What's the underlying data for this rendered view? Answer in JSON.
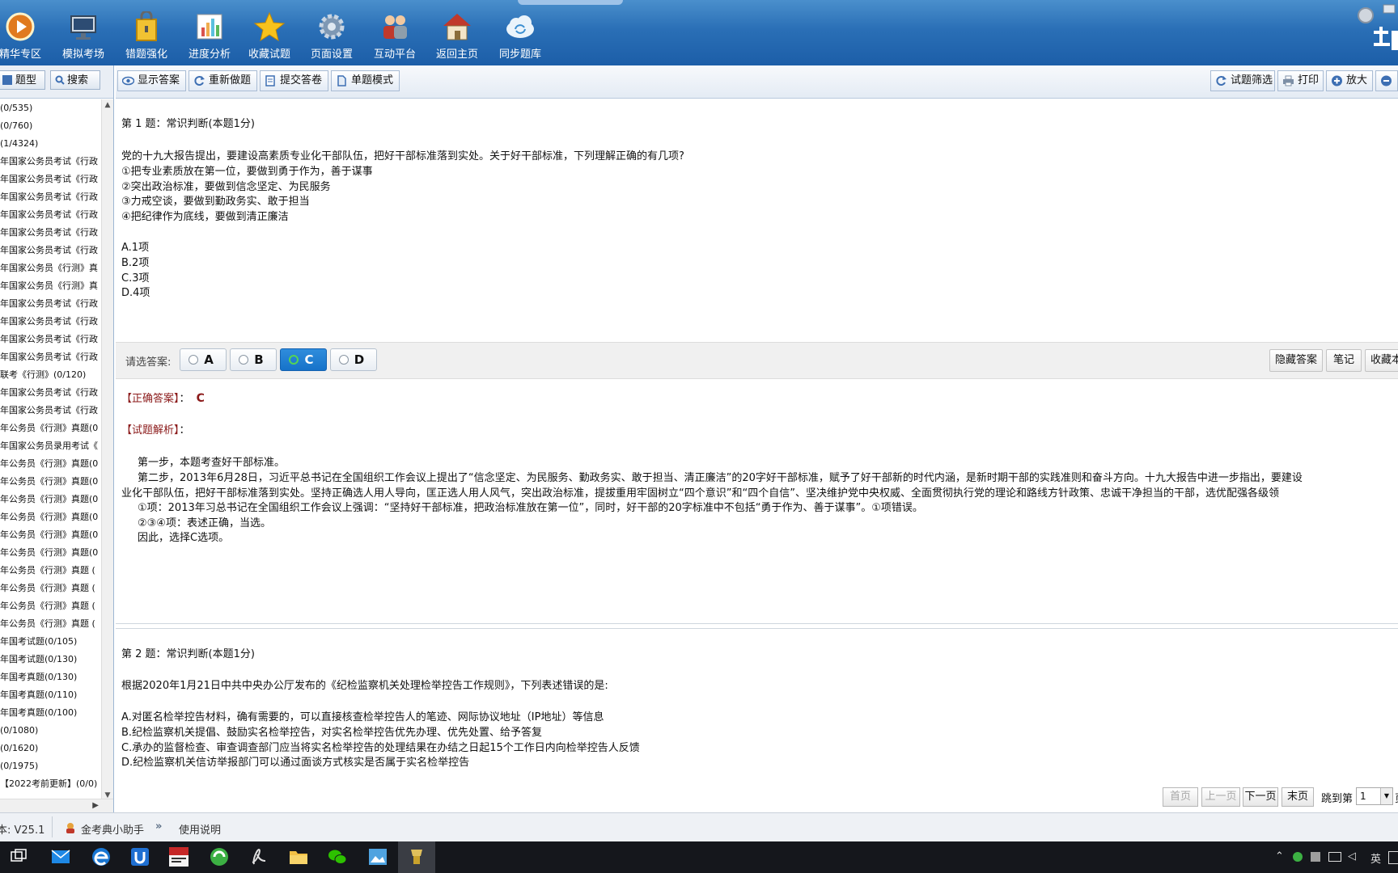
{
  "toolbar": {
    "items": [
      {
        "label": "精华专区",
        "icon": "play-icon"
      },
      {
        "label": "模拟考场",
        "icon": "monitor-icon"
      },
      {
        "label": "错题强化",
        "icon": "lock-book-icon"
      },
      {
        "label": "进度分析",
        "icon": "chart-icon"
      },
      {
        "label": "收藏试题",
        "icon": "star-icon"
      },
      {
        "label": "页面设置",
        "icon": "gear-icon"
      },
      {
        "label": "互动平台",
        "icon": "people-icon"
      },
      {
        "label": "返回主页",
        "icon": "home-icon"
      },
      {
        "label": "同步题库",
        "icon": "cloud-sync-icon"
      }
    ]
  },
  "left_panel": {
    "tab_type": "题型",
    "tab_search": "搜索",
    "items": [
      "(0/535)",
      "(0/760)",
      "(1/4324)",
      "年国家公务员考试《行政",
      "年国家公务员考试《行政",
      "年国家公务员考试《行政",
      "年国家公务员考试《行政",
      "年国家公务员考试《行政",
      "年国家公务员考试《行政",
      "年国家公务员《行测》真",
      "年国家公务员《行测》真",
      "年国家公务员考试《行政",
      "年国家公务员考试《行政",
      "年国家公务员考试《行政",
      "年国家公务员考试《行政",
      "联考《行测》(0/120)",
      "年国家公务员考试《行政",
      "年国家公务员考试《行政",
      "年公务员《行测》真题(0",
      "年国家公务员录用考试《",
      "年公务员《行测》真题(0",
      "年公务员《行测》真题(0",
      "年公务员《行测》真题(0",
      "年公务员《行测》真题(0",
      "年公务员《行测》真题(0",
      "年公务员《行测》真题(0",
      "年公务员《行测》真题 (",
      "年公务员《行测》真题 (",
      "年公务员《行测》真题 (",
      "年公务员《行测》真题 (",
      "年国考试题(0/105)",
      "年国考试题(0/130)",
      "年国考真题(0/130)",
      "年国考真题(0/110)",
      "年国考真题(0/100)",
      "(0/1080)",
      "(0/1620)",
      "(0/1975)",
      "【2022考前更新】(0/0)"
    ]
  },
  "subtoolbar": {
    "show_answer": "显示答案",
    "redo": "重新做题",
    "submit": "提交答卷",
    "single_mode": "单题模式",
    "filter": "试题筛选",
    "print": "打印",
    "zoom_in": "放大"
  },
  "question1": {
    "header": "第 1 题：常识判断(本题1分)",
    "stem": "党的十九大报告提出，要建设高素质专业化干部队伍，把好干部标准落到实处。关于好干部标准，下列理解正确的有几项?",
    "statements": [
      "①把专业素质放在第一位，要做到勇于作为，善于谋事",
      "②突出政治标准，要做到信念坚定、为民服务",
      "③力戒空谈，要做到勤政务实、敢于担当",
      "④把纪律作为底线，要做到清正廉洁"
    ],
    "options": [
      "A.1项",
      "B.2项",
      "C.3项",
      "D.4项"
    ],
    "select_prompt": "请选答案:",
    "choices": [
      "A",
      "B",
      "C",
      "D"
    ],
    "selected": "C",
    "hide_answer": "隐藏答案",
    "notes": "笔记",
    "collect": "收藏本",
    "correct_label": "【正确答案】",
    "correct_value": "C",
    "analysis_label": "【试题解析】",
    "analysis": [
      "第一步，本题考查好干部标准。",
      "第二步，2013年6月28日，习近平总书记在全国组织工作会议上提出了“信念坚定、为民服务、勤政务实、敢于担当、清正廉洁”的20字好干部标准，赋予了好干部新的时代内涵，是新时期干部的实践准则和奋斗方向。十九大报告中进一步指出，要建设",
      "业化干部队伍，把好干部标准落到实处。坚持正确选人用人导向，匡正选人用人风气，突出政治标准，提拔重用牢固树立“四个意识”和“四个自信”、坚决维护党中央权威、全面贯彻执行党的理论和路线方针政策、忠诚干净担当的干部，选优配强各级领",
      "①项：2013年习总书记在全国组织工作会议上强调：“坚持好干部标准，把政治标准放在第一位”，同时，好干部的20字标准中不包括“勇于作为、善于谋事”。①项错误。",
      "②③④项：表述正确，当选。",
      "因此，选择C选项。"
    ]
  },
  "question2": {
    "header": "第 2 题：常识判断(本题1分)",
    "stem": "根据2020年1月21日中共中央办公厅发布的《纪检监察机关处理检举控告工作规则》，下列表述错误的是:",
    "options": [
      "A.对匿名检举控告材料，确有需要的，可以直接核查检举控告人的笔迹、网际协议地址（IP地址）等信息",
      "B.纪检监察机关提倡、鼓励实名检举控告，对实名检举控告优先办理、优先处置、给予答复",
      "C.承办的监督检查、审查调查部门应当将实名检举控告的处理结果在办结之日起15个工作日内向检举控告人反馈",
      "D.纪检监察机关信访举报部门可以通过面谈方式核实是否属于实名检举控告"
    ]
  },
  "pager": {
    "first": "首页",
    "prev": "上一页",
    "next": "下一页",
    "last": "末页",
    "jump_label": "跳到第",
    "jump_value": "1",
    "suffix": "页"
  },
  "statusbar": {
    "version": "本: V25.1",
    "assistant": "金考典小助手",
    "chevron": "»",
    "manual": "使用说明"
  },
  "taskbar": {
    "ime": "英",
    "icons": [
      "task-view-icon",
      "mail-icon",
      "edge-icon",
      "store-icon",
      "stc-icon",
      "360-icon",
      "pdf-icon",
      "folder-icon",
      "wechat-icon",
      "photo-icon",
      "exam-app-icon"
    ]
  },
  "colors": {
    "toolbar_blue": "#2a6fb6",
    "selected_option": "#1672c9",
    "label_red": "#8b1a1a"
  }
}
